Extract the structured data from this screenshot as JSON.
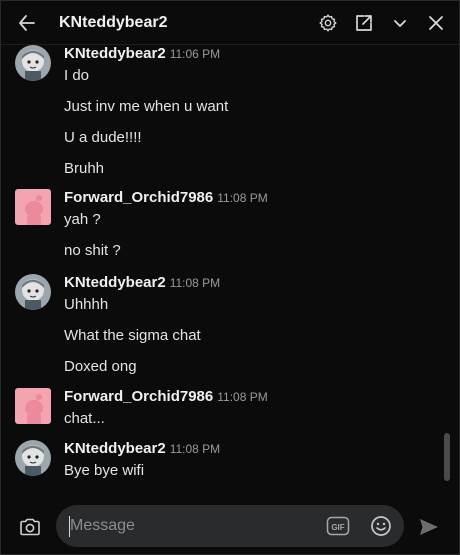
{
  "header": {
    "title": "KNteddybear2",
    "back_icon": "arrow-left-icon",
    "settings_icon": "gear-icon",
    "popout_icon": "popout-icon",
    "collapse_icon": "chevron-down-icon",
    "close_icon": "close-icon"
  },
  "messages": [
    {
      "user": "KNteddybear2",
      "time": "11:06 PM",
      "avatar": "teddy-avatar",
      "lines": [
        "I do",
        "Just inv me when u want",
        "U a dude!!!!",
        "Bruhh"
      ]
    },
    {
      "user": "Forward_Orchid7986",
      "time": "11:08 PM",
      "avatar": "orchid-avatar",
      "lines": [
        "yah ?",
        "no shit ?"
      ]
    },
    {
      "user": "KNteddybear2",
      "time": "11:08 PM",
      "avatar": "teddy-avatar",
      "lines": [
        "Uhhhh",
        "What the sigma chat",
        "Doxed ong"
      ]
    },
    {
      "user": "Forward_Orchid7986",
      "time": "11:08 PM",
      "avatar": "orchid-avatar",
      "lines": [
        "chat..."
      ]
    },
    {
      "user": "KNteddybear2",
      "time": "11:08 PM",
      "avatar": "teddy-avatar",
      "lines": [
        "Bye bye wifi"
      ]
    }
  ],
  "composer": {
    "placeholder": "Message",
    "camera_icon": "camera-icon",
    "gif_label": "GIF",
    "emoji_icon": "smiley-icon",
    "send_icon": "send-icon"
  },
  "colors": {
    "background": "#0b0b0b",
    "input_bg": "#2a2b2d",
    "orchid_avatar": "#f4a3b0"
  }
}
